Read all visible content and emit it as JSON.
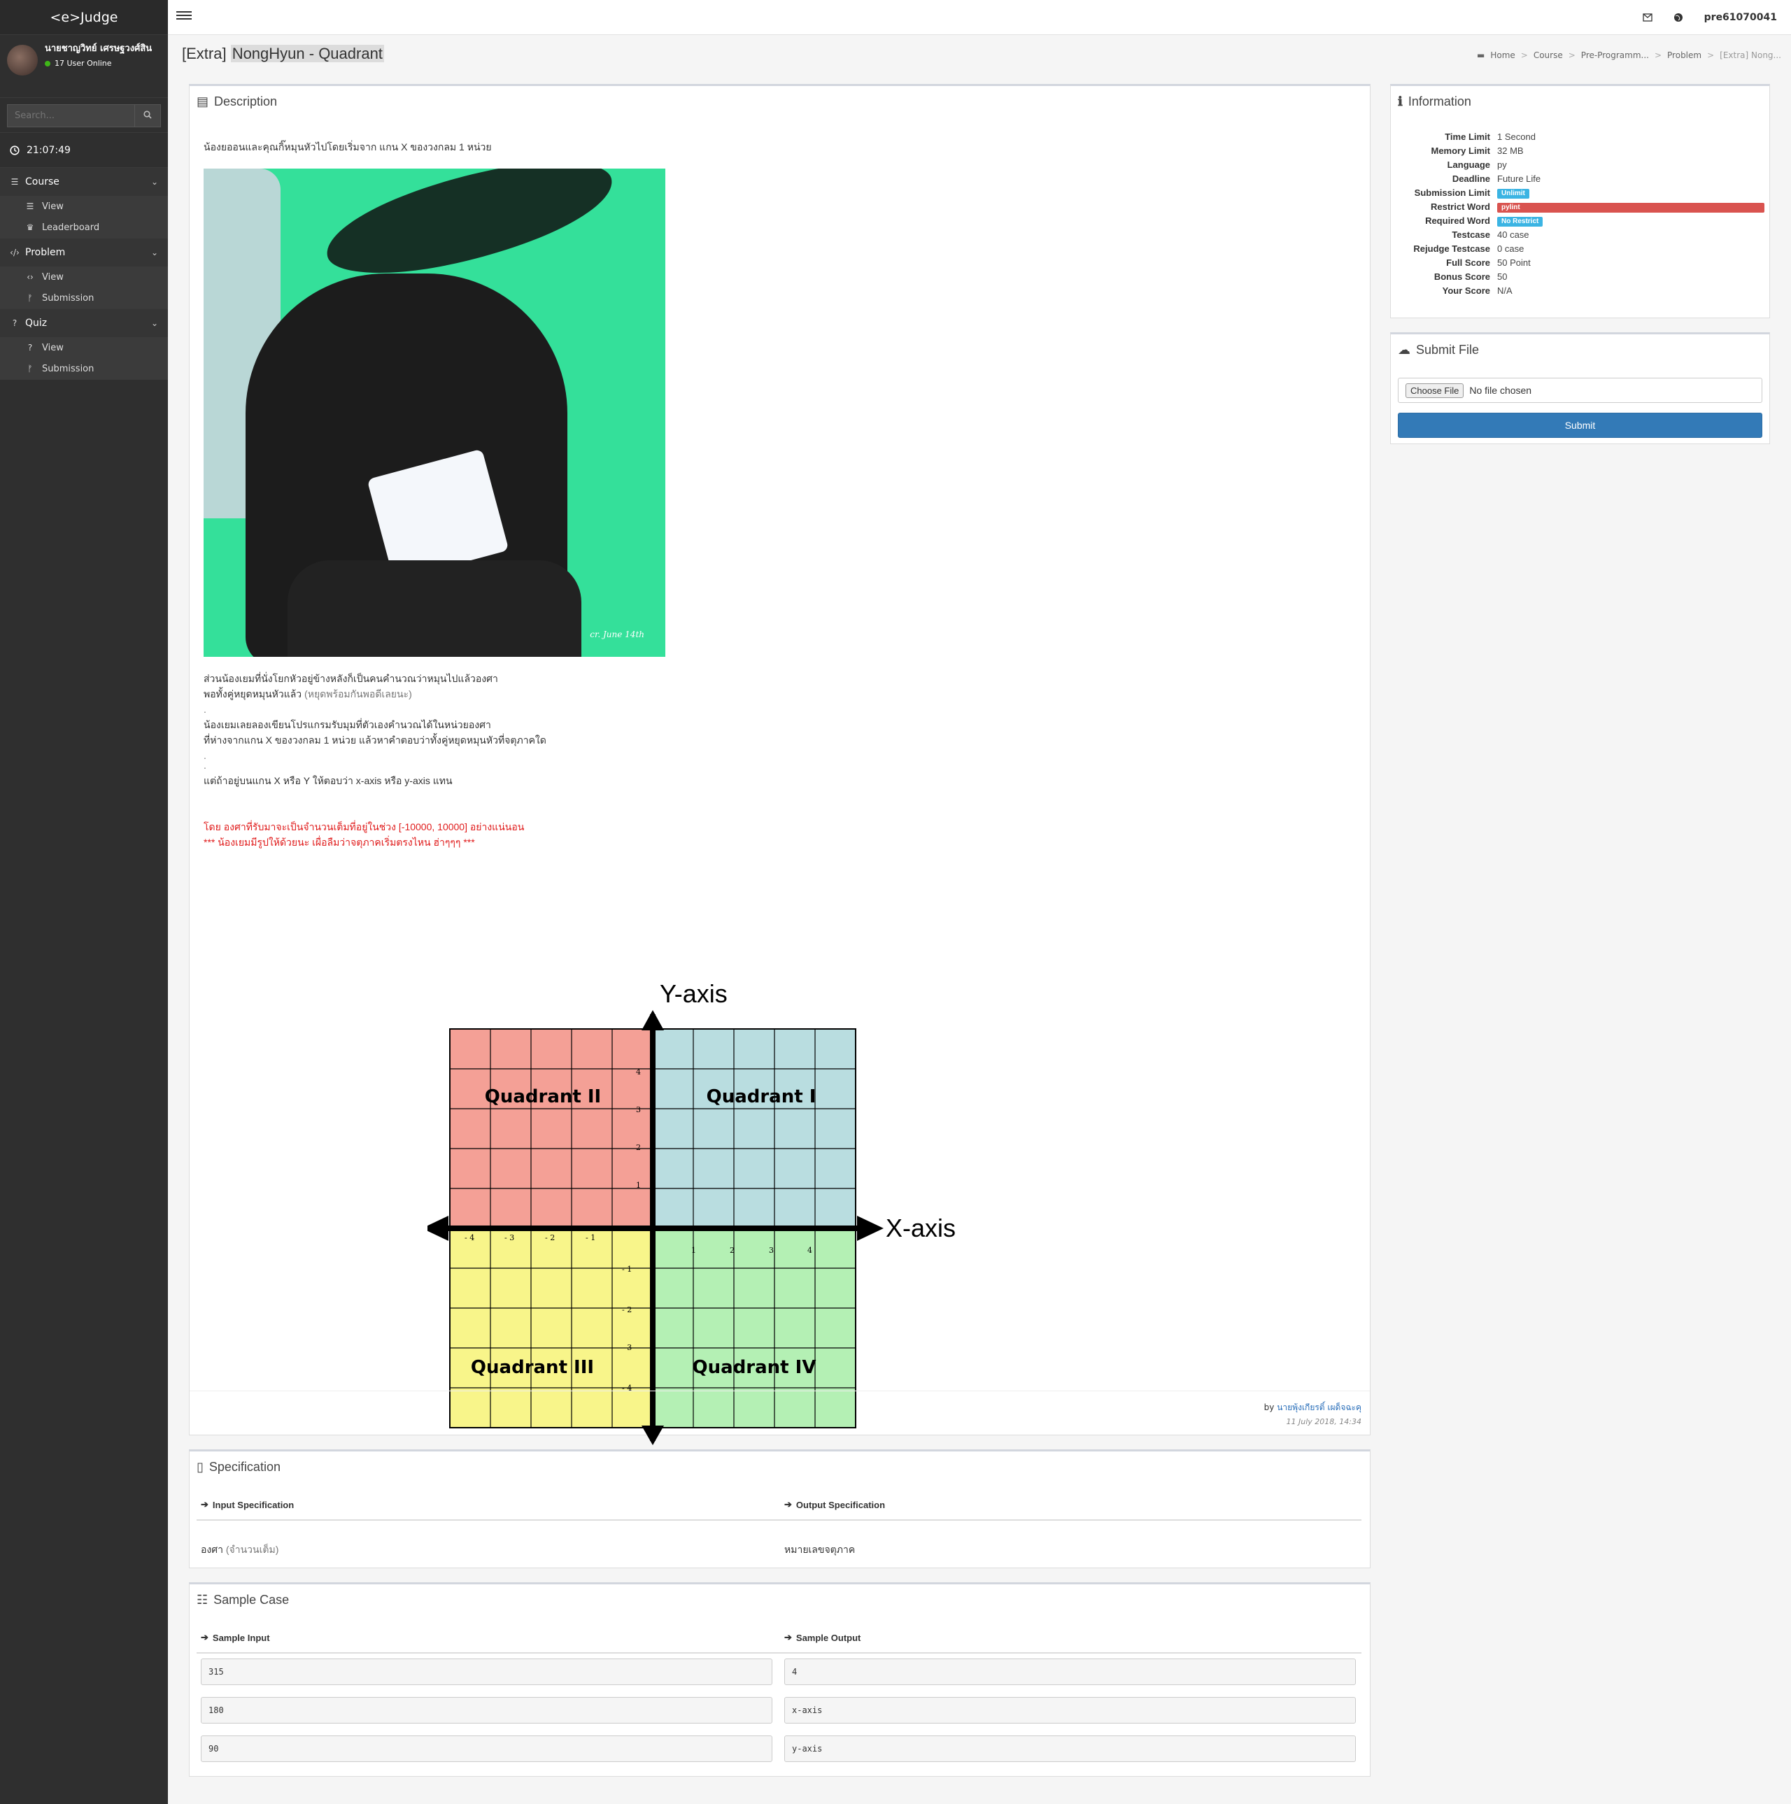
{
  "brand": "<e>Judge",
  "user": {
    "name": "นายชาญวิทย์ เศรษฐวงศ์สิน",
    "online": "17 User Online"
  },
  "search": {
    "placeholder": "Search..."
  },
  "clock": "21:07:49",
  "nav": [
    {
      "label": "Course",
      "items": [
        "View",
        "Leaderboard"
      ]
    },
    {
      "label": "Problem",
      "items": [
        "View",
        "Submission"
      ]
    },
    {
      "label": "Quiz",
      "items": [
        "View",
        "Submission"
      ]
    }
  ],
  "topbar": {
    "username": "pre61070041"
  },
  "page": {
    "title_prefix": "[Extra] ",
    "title_main": "NongHyun - Quadrant"
  },
  "breadcrumb": [
    "Home",
    "Course",
    "Pre-Programm...",
    "Problem",
    "[Extra] Nong..."
  ],
  "description": {
    "title": "Description",
    "intro": "น้องยออนและคุณกิ๊หมุนหัวไปโดยเริ่มจาก แกน X  ของวงกลม 1 หน่วย",
    "photo_watermark": "cr. June 14th",
    "para1_line1": "ส่วนน้องเยมที่นั่งโยกหัวอยู่ข้างหลังก็เป็นคนคำนวณว่าหมุนไปแล้วองศา",
    "para1_line2": "พอทั้งคู่หยุดหมุนหัวแล้ว",
    "para1_line2_muted": " (หยุดพร้อมกันพอดีเลยนะ)",
    "dot": ".",
    "para2_line1": "น้องเยมเลยลองเขียนโปรแกรมรับมุมที่ตัวเองคำนวณได้ในหน่วยองศา",
    "para2_line2": "ที่ห่างจากแกน X ของวงกลม 1 หน่วย แล้วหาคำตอบว่าทั้งคู่หยุดหมุนหัวที่จตุภาคใด",
    "para3": "แต่ถ้าอยู่บนแกน X หรือ Y ให้ตอบว่า  x-axis หรือ y-axis แทน",
    "red1": "โดย องศาที่รับมาจะเป็นจำนวนเต็มที่อยู่ในช่วง [-10000, 10000] อย่างแน่นอน",
    "red2": "*** น้องเยมมีรูปให้ด้วยนะ  เผื่อลืมว่าจตุภาคเริ่มตรงไหน ฮ่าๆๆๆ  ***",
    "author": "นายพุ้งเกียรติ์ เผด็จฉะคุ",
    "by": "by ",
    "date": "11 July 2018, 14:34"
  },
  "quadrant_chart": {
    "y_label": "Y-axis",
    "x_label": "X-axis",
    "q1": "Quadrant I",
    "q2": "Quadrant II",
    "q3": "Quadrant III",
    "q4": "Quadrant IV",
    "colors": {
      "q1": "#b9dde0",
      "q2": "#f4a096",
      "q3": "#f8f58a",
      "q4": "#b4f0b4"
    }
  },
  "specification": {
    "title": "Specification",
    "input_title": "Input Specification",
    "output_title": "Output Specification",
    "input_value": "องศา",
    "input_value_muted": " (จำนวนเต็ม)",
    "output_value": "หมายเลขจตุภาค"
  },
  "sample": {
    "title": "Sample Case",
    "input_title": "Sample Input",
    "output_title": "Sample Output",
    "inputs": [
      "315",
      "180",
      "90"
    ],
    "outputs": [
      "4",
      "x-axis",
      "y-axis"
    ]
  },
  "information": {
    "title": "Information",
    "rows": [
      {
        "key": "Time Limit",
        "value": "1 Second"
      },
      {
        "key": "Memory Limit",
        "value": "32 MB"
      },
      {
        "key": "Language",
        "value": "py"
      },
      {
        "key": "Deadline",
        "value": "Future Life"
      },
      {
        "key": "Submission Limit",
        "badge": "Unlimit"
      },
      {
        "key": "Restrict Word",
        "badge": "pylint"
      },
      {
        "key": "Required Word",
        "badge": "No Restrict"
      },
      {
        "key": "Testcase",
        "value": "40 case"
      },
      {
        "key": "Rejudge Testcase",
        "value": "0 case"
      },
      {
        "key": "Full Score",
        "value": "50 Point"
      },
      {
        "key": "Bonus Score",
        "value": "50"
      },
      {
        "key": "Your Score",
        "value": "N/A"
      }
    ]
  },
  "submit": {
    "title": "Submit File",
    "choose": "Choose File",
    "nofile": "No file chosen",
    "button": "Submit"
  }
}
